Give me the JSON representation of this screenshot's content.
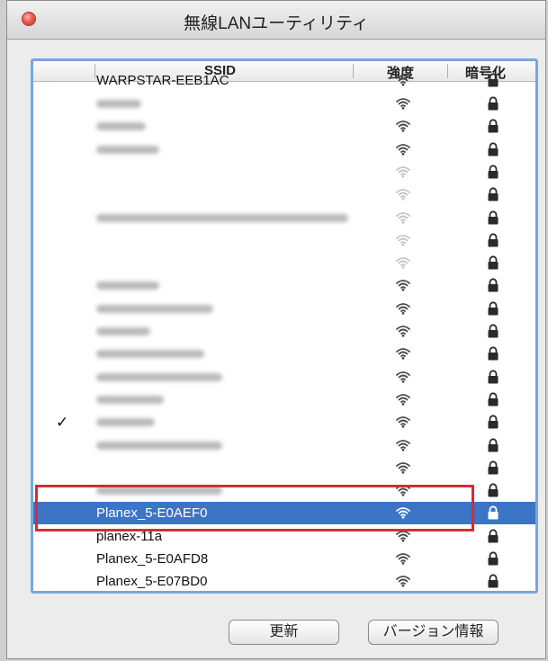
{
  "window": {
    "title": "無線LANユーティリティ"
  },
  "table": {
    "headers": {
      "ssid": "SSID",
      "strength": "強度",
      "encryption": "暗号化"
    },
    "rows": [
      {
        "ssid": "WARPSTAR-EEB1AC",
        "blurred": false,
        "partial": true,
        "signal": "strong",
        "secured": true
      },
      {
        "ssid": "",
        "blurred": true,
        "blur_len": 50,
        "signal": "strong",
        "secured": true
      },
      {
        "ssid": "",
        "blurred": true,
        "blur_len": 55,
        "signal": "strong",
        "secured": true
      },
      {
        "ssid": "",
        "blurred": true,
        "blur_len": 70,
        "signal": "strong",
        "secured": true
      },
      {
        "ssid": "",
        "blurred": false,
        "signal": "weak",
        "secured": true
      },
      {
        "ssid": "",
        "blurred": false,
        "signal": "weak",
        "secured": true
      },
      {
        "ssid": "",
        "blurred": true,
        "blur_len": 280,
        "signal": "weak",
        "secured": true
      },
      {
        "ssid": "",
        "blurred": false,
        "signal": "weak",
        "secured": true
      },
      {
        "ssid": "",
        "blurred": false,
        "signal": "weak",
        "secured": true
      },
      {
        "ssid": "",
        "blurred": true,
        "blur_len": 70,
        "signal": "strong",
        "secured": true
      },
      {
        "ssid": "",
        "blurred": true,
        "blur_len": 130,
        "signal": "strong",
        "secured": true
      },
      {
        "ssid": "",
        "blurred": true,
        "blur_len": 60,
        "signal": "strong",
        "secured": true
      },
      {
        "ssid": "",
        "blurred": true,
        "blur_len": 120,
        "signal": "strong",
        "secured": true
      },
      {
        "ssid": "",
        "blurred": true,
        "blur_len": 140,
        "signal": "strong",
        "secured": true
      },
      {
        "ssid": "",
        "blurred": true,
        "blur_len": 75,
        "signal": "strong",
        "secured": true
      },
      {
        "ssid": "",
        "blurred": true,
        "blur_len": 65,
        "signal": "strong",
        "secured": true,
        "connected": true,
        "check_mark": "✓"
      },
      {
        "ssid": "",
        "blurred": true,
        "blur_len": 140,
        "signal": "strong",
        "secured": true
      },
      {
        "ssid": "",
        "blurred": false,
        "signal": "strong",
        "secured": true
      },
      {
        "ssid": "",
        "blurred": true,
        "blur_len": 140,
        "signal": "strong",
        "secured": true
      },
      {
        "ssid": "Planex_5-E0AEF0",
        "blurred": false,
        "signal": "strong",
        "secured": true,
        "selected": true
      },
      {
        "ssid": "planex-11a",
        "blurred": false,
        "signal": "strong",
        "secured": true
      },
      {
        "ssid": "Planex_5-E0AFD8",
        "blurred": false,
        "signal": "strong",
        "secured": true
      },
      {
        "ssid": "Planex_5-E07BD0",
        "blurred": false,
        "signal": "strong",
        "secured": true
      }
    ]
  },
  "buttons": {
    "refresh": "更新",
    "version_info": "バージョン情報"
  },
  "colors": {
    "selection": "#3c74c6",
    "highlight_box": "#d42c33",
    "list_border": "#76a7d8"
  },
  "icons": {
    "signal": "wifi-signal-icon",
    "lock": "lock-icon",
    "check": "checkmark-icon",
    "close": "close-icon"
  }
}
